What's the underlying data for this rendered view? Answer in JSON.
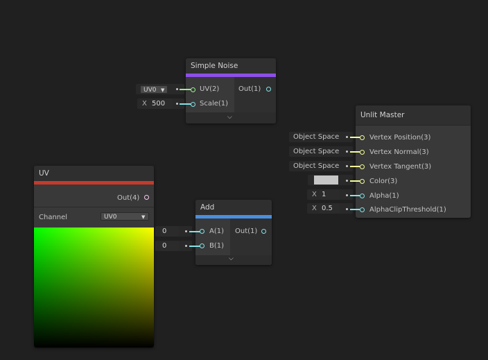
{
  "simple_noise": {
    "title": "Simple Noise",
    "inputs": [
      "UV(2)",
      "Scale(1)"
    ],
    "output": "Out(1)",
    "uv_dropdown": "UV0",
    "scale_axis": "X",
    "scale_value": "500"
  },
  "unlit_master": {
    "title": "Unlit Master",
    "inputs": [
      "Vertex Position(3)",
      "Vertex Normal(3)",
      "Vertex Tangent(3)",
      "Color(3)",
      "Alpha(1)",
      "AlphaClipThreshold(1)"
    ],
    "space_labels": [
      "Object Space",
      "Object Space",
      "Object Space"
    ],
    "color_swatch": "#c6c6c6",
    "alpha_axis": "X",
    "alpha_value": "1",
    "clip_axis": "X",
    "clip_value": "0.5"
  },
  "uv_node": {
    "title": "UV",
    "output": "Out(4)",
    "channel_label": "Channel",
    "channel_value": "UV0"
  },
  "add_node": {
    "title": "Add",
    "inputs": [
      "A(1)",
      "B(1)"
    ],
    "output": "Out(1)",
    "a_value": "0",
    "b_value": "0"
  },
  "colors": {
    "background": "#202020",
    "node_body": "#393939",
    "simple_noise_accent": "#8d4fe8",
    "uv_accent": "#c63a2c",
    "add_accent": "#4a8fe0",
    "float_port": "#84e4e7",
    "vector2_port": "#9aef92",
    "vector3_port": "#f6ff9a",
    "vector4_port": "#fbcbf4"
  }
}
